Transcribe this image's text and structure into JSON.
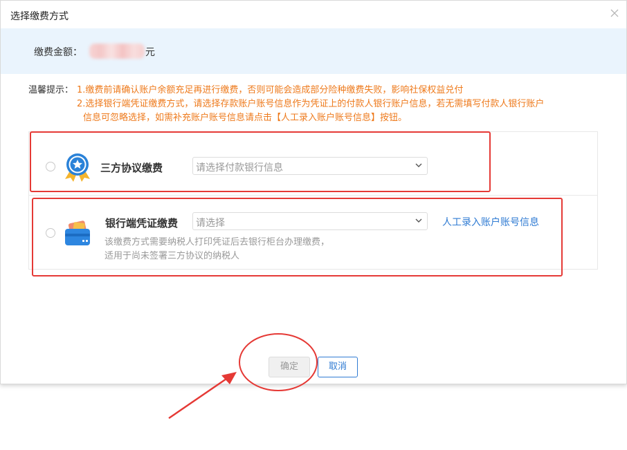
{
  "dialog": {
    "title": "选择缴费方式"
  },
  "amount": {
    "label": "缴费金额：",
    "unit": "元"
  },
  "tips": {
    "label": "温馨提示：",
    "line1": "1.缴费前请确认账户余额充足再进行缴费，否则可能会造成部分险种缴费失败，影响社保权益兑付",
    "line2": "2.选择银行端凭证缴费方式，请选择存款账户账号信息作为凭证上的付款人银行账户信息，若无需填写付款人银行账户",
    "line3": "信息可忽略选择，如需补充账户账号信息请点击【人工录入账户账号信息】按钮。"
  },
  "options": [
    {
      "title": "三方协议缴费",
      "select_placeholder": "请选择付款银行信息",
      "icon": "badge-medal-icon"
    },
    {
      "title": "银行端凭证缴费",
      "select_placeholder": "请选择",
      "link": "人工录入账户账号信息",
      "desc_line1": "该缴费方式需要纳税人打印凭证后去银行柜台办理缴费，",
      "desc_line2": "适用于尚未签署三方协议的纳税人",
      "icon": "bank-card-icon"
    }
  ],
  "buttons": {
    "confirm": "确定",
    "cancel": "取消"
  },
  "colors": {
    "accent": "#2f7bd3",
    "warning": "#ee7a1c",
    "annotation": "#e53935",
    "amount_bg": "#eaf4fd"
  }
}
